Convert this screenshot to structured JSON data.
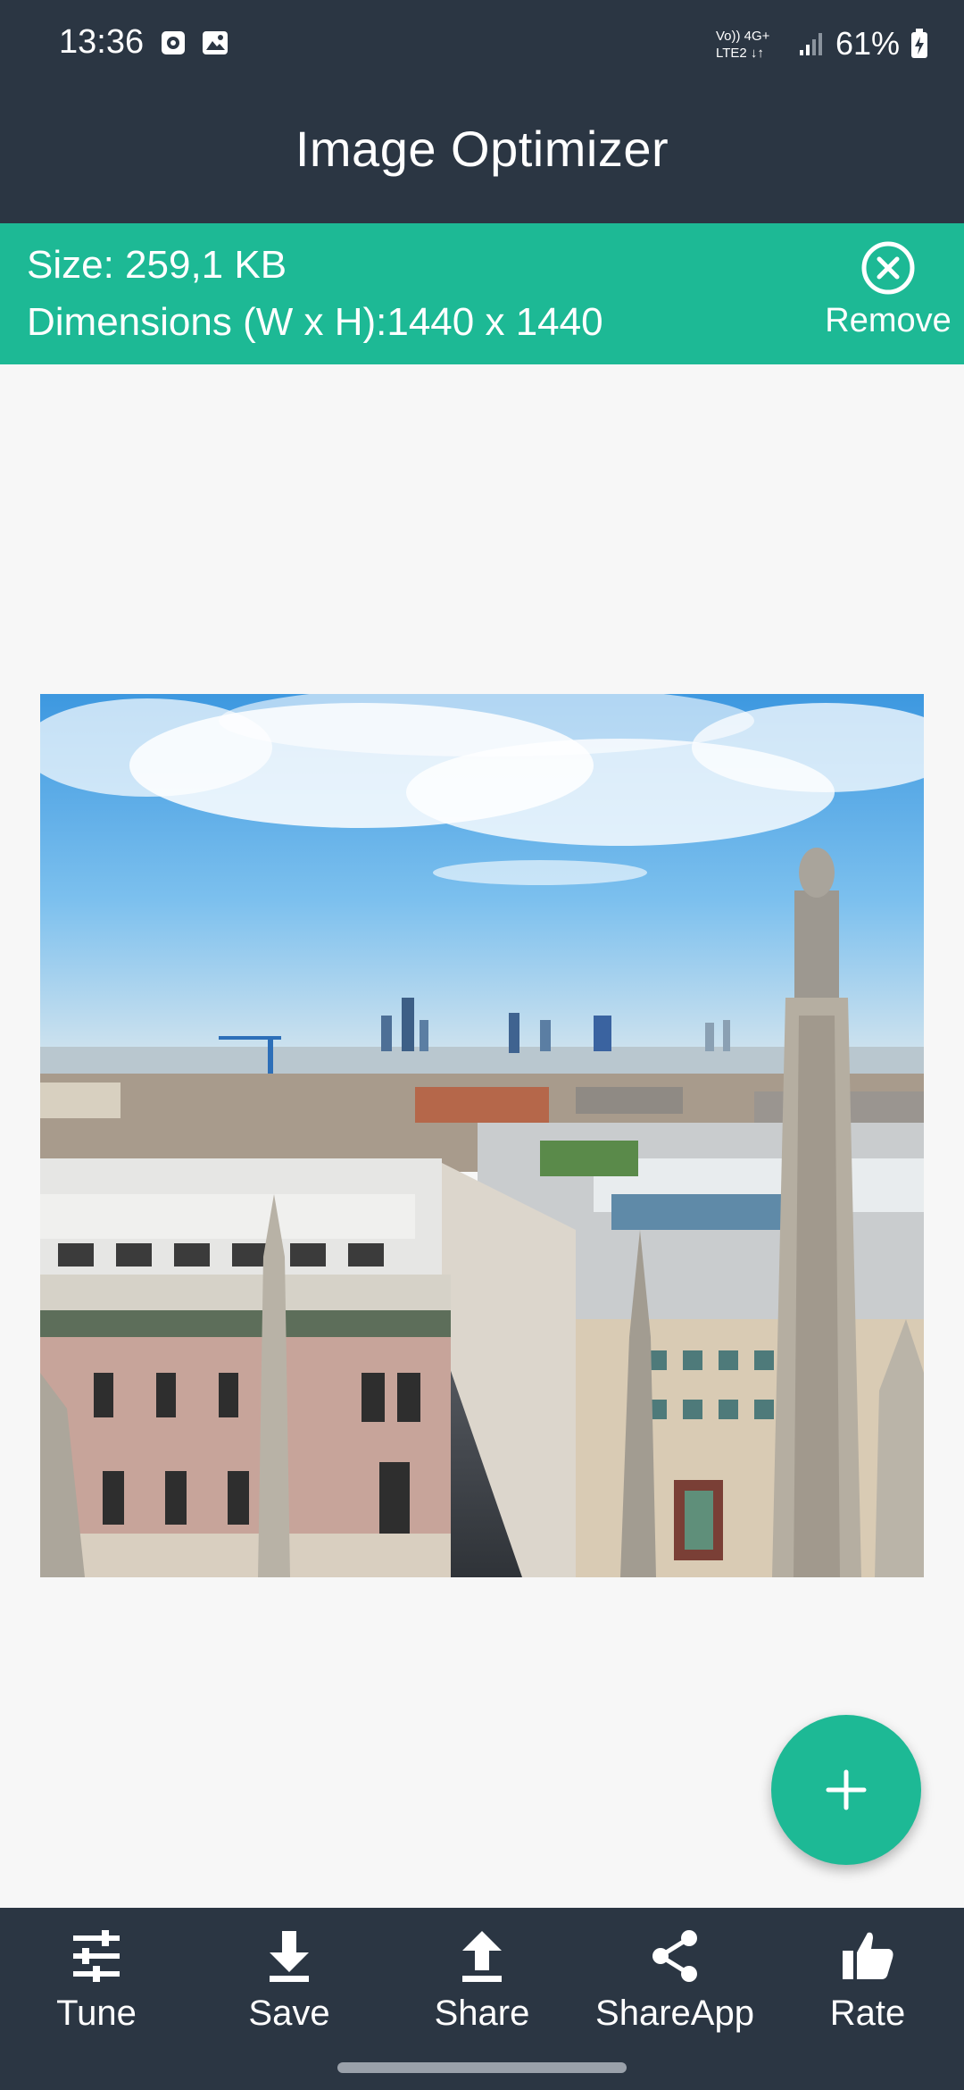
{
  "status_bar": {
    "time": "13:36",
    "network_label": "Vo) 4G+\nLTE2",
    "battery": "61%",
    "icons": [
      "alarm-icon",
      "gallery-icon",
      "volte-icon",
      "signal-icon",
      "battery-charging-icon"
    ]
  },
  "app": {
    "title": "Image Optimizer"
  },
  "image_info": {
    "size": "Size: 259,1 KB",
    "dimensions": "Dimensions (W x H):1440 x 1440",
    "remove_label": "Remove"
  },
  "bottom_nav": [
    {
      "label": "Tune",
      "icon": "tune-icon"
    },
    {
      "label": "Save",
      "icon": "download-icon"
    },
    {
      "label": "Share",
      "icon": "upload-icon"
    },
    {
      "label": "ShareApp",
      "icon": "share-icon"
    },
    {
      "label": "Rate",
      "icon": "thumbs-up-icon"
    }
  ],
  "colors": {
    "dark": "#2b3643",
    "accent": "#1db995",
    "background": "#f7f7f7"
  }
}
